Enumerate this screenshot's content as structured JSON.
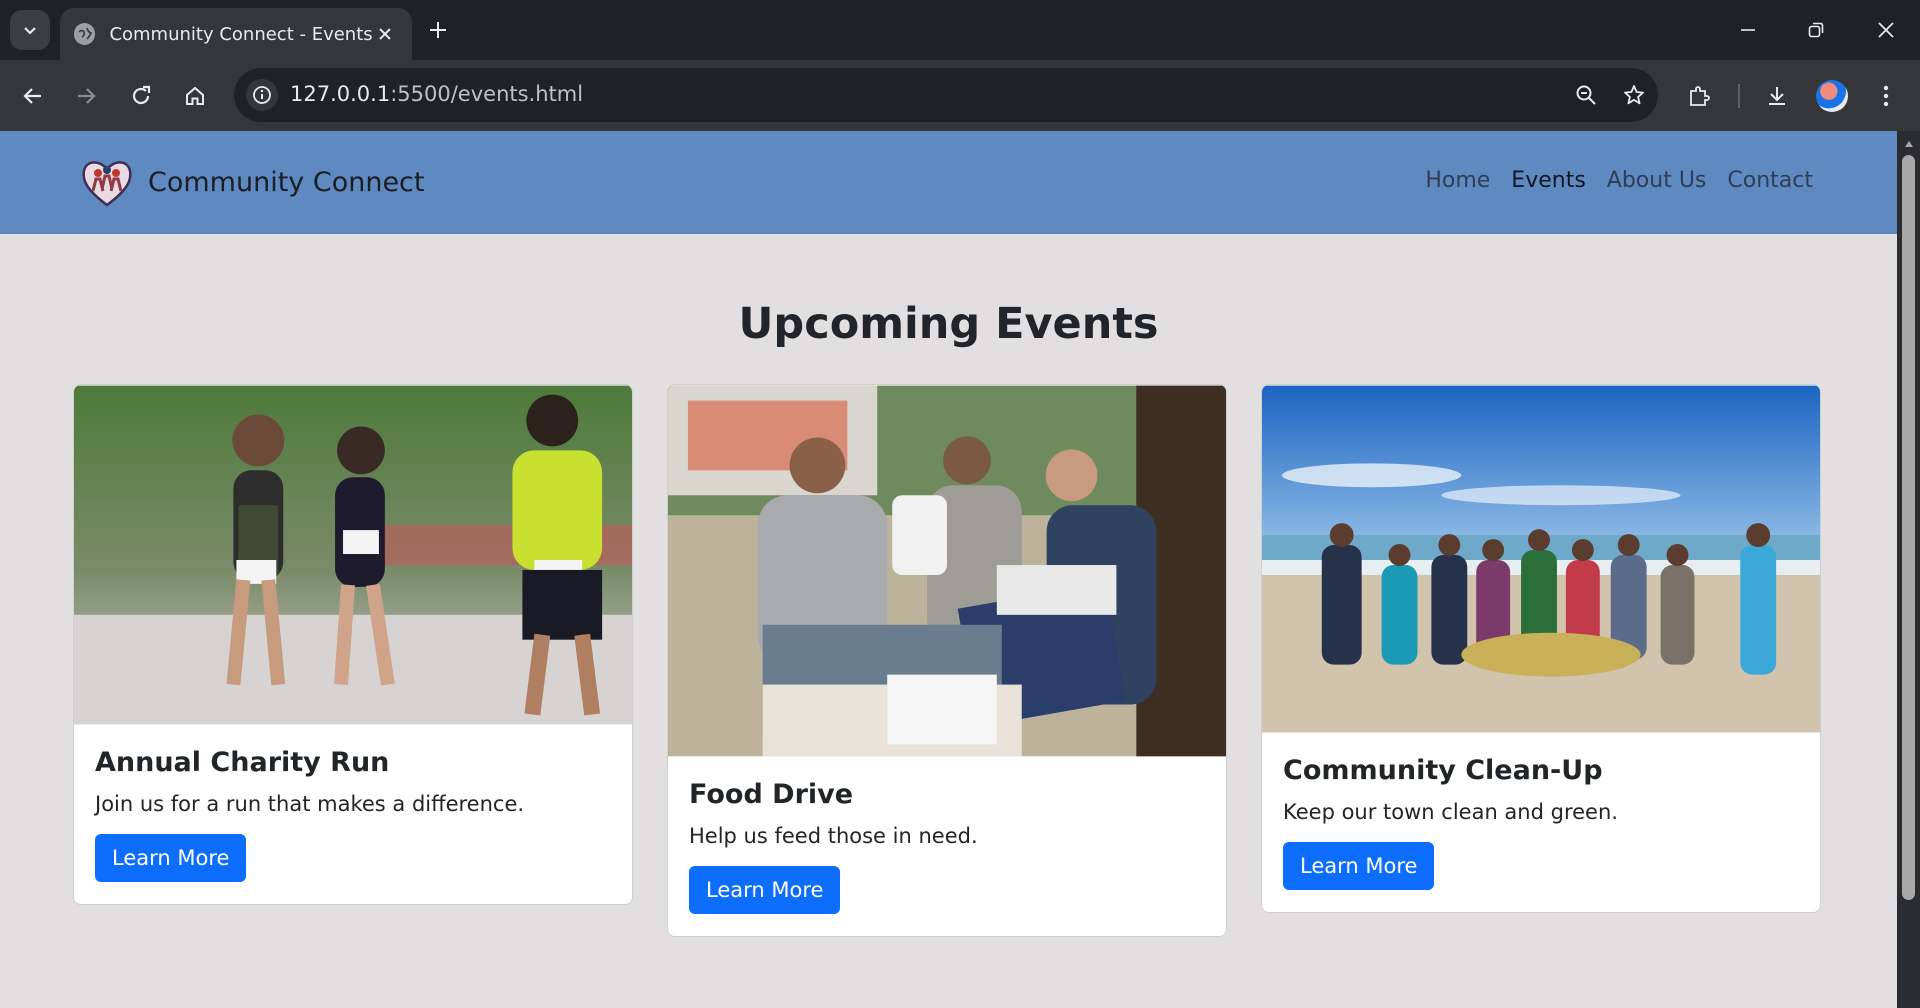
{
  "browser": {
    "tab_title": "Community Connect - Events",
    "url_host": "127.0.0.1",
    "url_path": ":5500/events.html"
  },
  "site": {
    "brand": "Community Connect",
    "nav": [
      "Home",
      "Events",
      "About Us",
      "Contact"
    ],
    "active_nav": "Events"
  },
  "page": {
    "title": "Upcoming Events"
  },
  "events": [
    {
      "title": "Annual Charity Run",
      "text": "Join us for a run that makes a difference.",
      "button": "Learn More",
      "image_icon": "runners-photo"
    },
    {
      "title": "Food Drive",
      "text": "Help us feed those in need.",
      "button": "Learn More",
      "image_icon": "food-donation-photo"
    },
    {
      "title": "Community Clean-Up",
      "text": "Keep our town clean and green.",
      "button": "Learn More",
      "image_icon": "beach-cleanup-photo"
    }
  ],
  "colors": {
    "navbar": "#5e89c1",
    "page_bg": "#e2dfe1",
    "button": "#0d6efd"
  }
}
